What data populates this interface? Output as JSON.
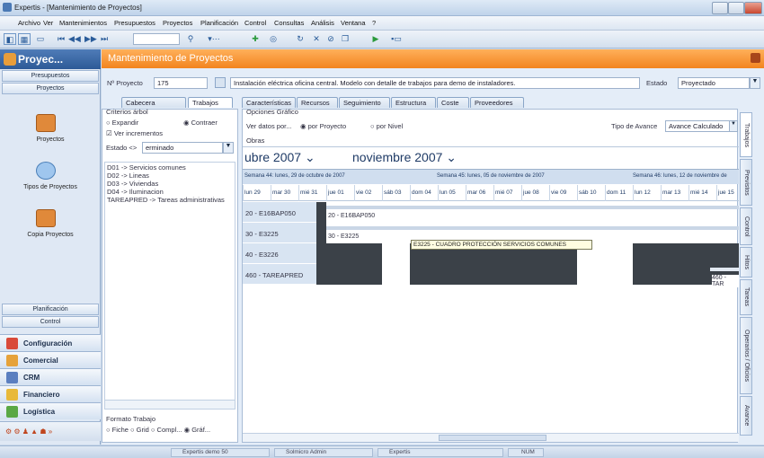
{
  "window": {
    "title": "Expertis - [Mantenimiento de Proyectos]"
  },
  "menu": [
    "Archivo",
    "Ver",
    "Mantenimientos",
    "Presupuestos",
    "Proyectos",
    "Planificación",
    "Control",
    "Consultas",
    "Análisis",
    "Ventana",
    "?"
  ],
  "sidebar": {
    "title": "Proyec...",
    "tabs_top": [
      "Presupuestos",
      "Proyectos"
    ],
    "items": [
      "Proyectos",
      "Tipos de Proyectos",
      "Copia Proyectos"
    ],
    "tabs_bottom": [
      "Planificación",
      "Control"
    ],
    "modules": [
      "Configuración",
      "Comercial",
      "CRM",
      "Financiero",
      "Logística"
    ]
  },
  "main": {
    "title": "Mantenimiento de Proyectos",
    "nproyecto_label": "Nº Proyecto",
    "nproyecto_value": "175",
    "description": "Instalación eléctrica oficina central. Modelo con detalle de trabajos para demo de instaladores.",
    "estado_label": "Estado",
    "estado_value": "Proyectado",
    "tabs_left": [
      "Cabecera Proyecto",
      "Trabajos"
    ],
    "tabs_right": [
      "Características",
      "Recursos",
      "Seguimiento",
      "Estructura",
      "Coste",
      "Proveedores"
    ],
    "criterios": "Criterios árbol",
    "expandir": "Expandir",
    "contraer": "Contraer",
    "ver_incrementos": "Ver incrementos",
    "estado_filter": "Estado <>",
    "estado_filter_value": "erminado",
    "tree": [
      "D01 -> Servicios comunes",
      "D02 -> Lineas",
      "D03 -> Viviendas",
      "D04 -> Iluminacion",
      "TAREAPRED -> Tareas administrativas"
    ],
    "formato_trabajo": "Formato Trabajo",
    "formato_options": [
      "Fiche",
      "Grid",
      "Compl...",
      "Gráf..."
    ],
    "opciones_grafico": "Opciones Gráfico",
    "ver_datos": "Ver datos por...",
    "por_proyecto": "por Proyecto",
    "por_nivel": "por Nivel",
    "tipo_avance_label": "Tipo de Avance",
    "tipo_avance_value": "Avance Calculado",
    "obras": "Obras",
    "months": [
      "ubre 2007",
      "noviembre 2007"
    ],
    "weeks": [
      "Semana 44: lunes, 29 de octubre de 2007",
      "Semana 45: lunes, 05 de noviembre de 2007",
      "Semana 46: lunes, 12 de noviembre de"
    ],
    "days": [
      "lun 29",
      "mar 30",
      "mié 31",
      "jue 01",
      "vie 02",
      "sáb 03",
      "dom 04",
      "lun 05",
      "mar 06",
      "mié 07",
      "jue 08",
      "vie 09",
      "sáb 10",
      "dom 11",
      "lun 12",
      "mar 13",
      "mié 14",
      "jue 15",
      "v"
    ],
    "rows": [
      "20 - E16BAP050",
      "30 - E3225",
      "40 - E3226",
      "460 - TAREAPRED"
    ],
    "bar_labels": [
      "20 - E16BAP050",
      "30 - E3225",
      "460 - TAR"
    ],
    "tooltip": "E3225 - CUADRO PROTECCIÓN SERVICIOS COMUNES",
    "vtabs": [
      "Trabajos",
      "Previstos",
      "Control",
      "Hitos",
      "Tareas",
      "Operarios / Oficios",
      "Avance"
    ]
  },
  "status": [
    "Expertis demo 50",
    "Solmicro Admin",
    "Expertis",
    "NUM"
  ]
}
